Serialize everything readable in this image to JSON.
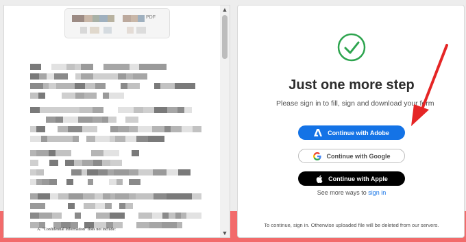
{
  "doc_viewer": {
    "toolbar_label": "PDF",
    "footnote": "A. \"Confidential Information\" does not include:"
  },
  "signin": {
    "title": "Just one more step",
    "subtitle": "Please sign in to fill, sign and download your form",
    "buttons": {
      "adobe": "Continue with Adobe",
      "google": "Continue with Google",
      "apple": "Continue with Apple"
    },
    "more_ways_prefix": "See more ways to",
    "more_ways_link": "sign in",
    "notice": "To continue, sign in. Otherwise uploaded file will be deleted from our servers."
  },
  "colors": {
    "accent": "#1473e6",
    "success": "#2da44e",
    "annotation_arrow": "#e52525",
    "band": "#f26b6b"
  }
}
